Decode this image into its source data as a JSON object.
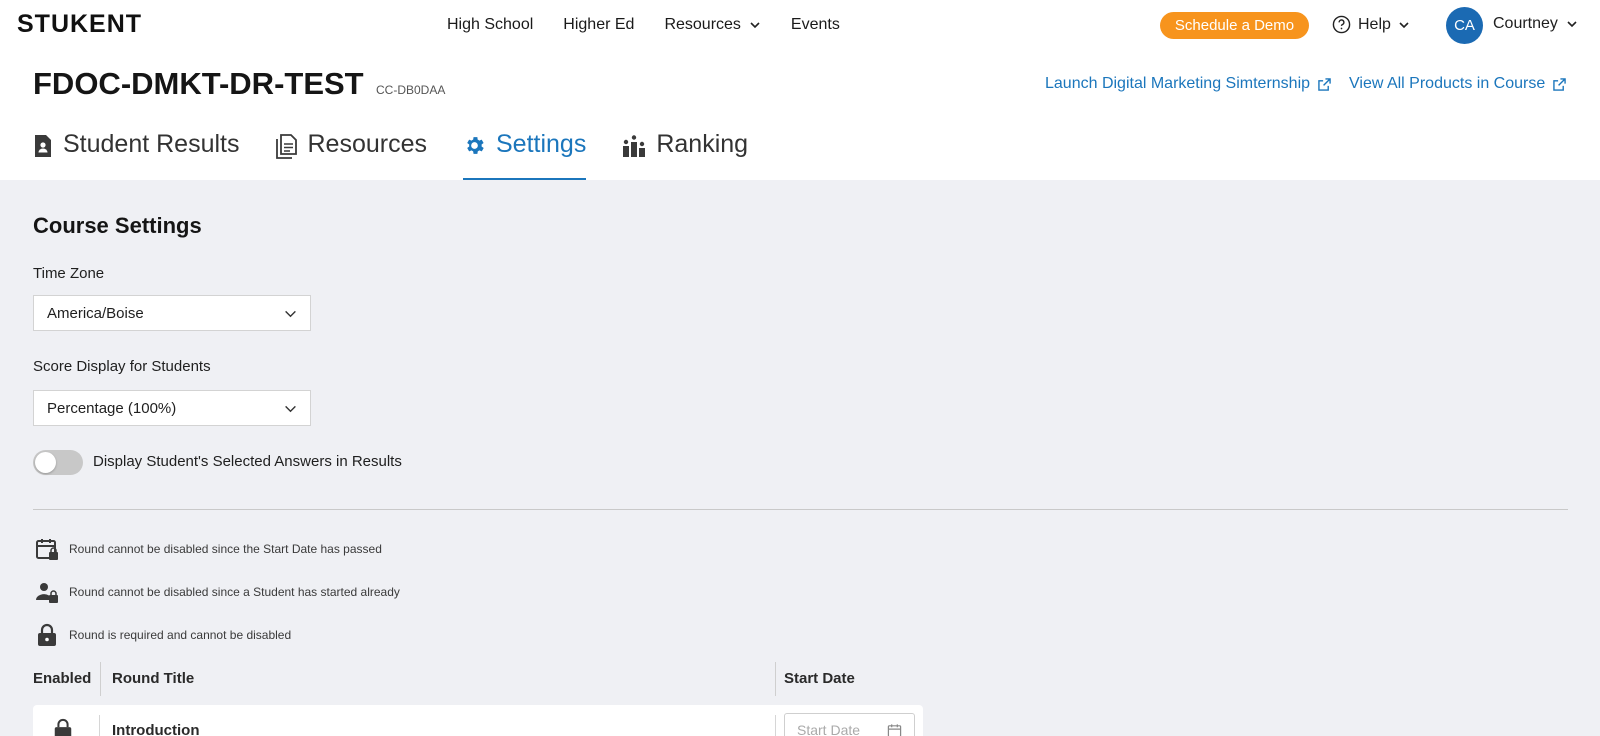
{
  "nav": {
    "logo": "STUKENT",
    "links": [
      "High School",
      "Higher Ed",
      "Resources",
      "Events"
    ],
    "demo_label": "Schedule a Demo",
    "help_label": "Help",
    "avatar_initials": "CA",
    "user_name": "Courtney"
  },
  "header": {
    "title": "FDOC-DMKT-DR-TEST",
    "code": "CC-DB0DAA",
    "link_launch": "Launch Digital Marketing Simternship",
    "link_view_all": "View All Products in Course"
  },
  "tabs": [
    {
      "label": "Student Results",
      "icon": "student-results-icon"
    },
    {
      "label": "Resources",
      "icon": "resources-icon"
    },
    {
      "label": "Settings",
      "icon": "gear-icon",
      "active": true
    },
    {
      "label": "Ranking",
      "icon": "ranking-icon"
    }
  ],
  "settings": {
    "title": "Course Settings",
    "time_zone_label": "Time Zone",
    "time_zone_value": "America/Boise",
    "score_display_label": "Score Display for Students",
    "score_display_value": "Percentage (100%)",
    "toggle_label": "Display Student's Selected Answers in Results",
    "toggle_on": false
  },
  "legend": [
    {
      "icon": "calendar-lock-icon",
      "text": "Round cannot be disabled since the Start Date has passed"
    },
    {
      "icon": "user-lock-icon",
      "text": "Round cannot be disabled since a Student has started already"
    },
    {
      "icon": "lock-icon",
      "text": "Round is required and cannot be disabled"
    }
  ],
  "table": {
    "headers": [
      "Enabled",
      "Round Title",
      "Start Date"
    ],
    "rows": [
      {
        "title": "Introduction",
        "start_date_placeholder": "Start Date"
      }
    ]
  },
  "colors": {
    "accent": "#1b76bc",
    "demo_button": "#f7941d",
    "avatar": "#1b6ab3",
    "background_main": "#eff0f4"
  }
}
